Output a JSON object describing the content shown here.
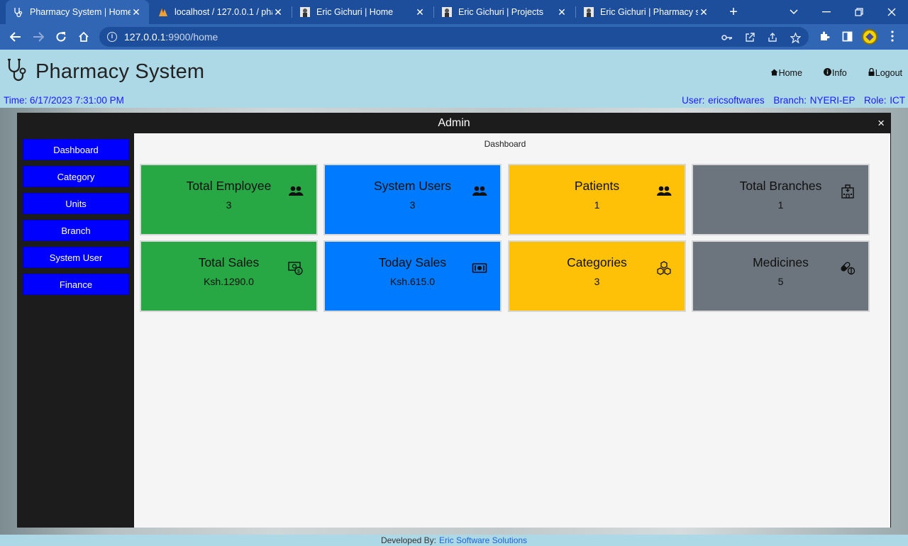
{
  "browser": {
    "tabs": [
      {
        "title": "Pharmacy System | Home"
      },
      {
        "title": "localhost / 127.0.0.1 / pha"
      },
      {
        "title": "Eric Gichuri | Home"
      },
      {
        "title": "Eric Gichuri | Projects"
      },
      {
        "title": "Eric Gichuri | Pharmacy sy"
      }
    ],
    "url_host": "127.0.0.1",
    "url_rest": ":9900/home"
  },
  "header": {
    "app_title": "Pharmacy System",
    "nav": [
      {
        "label": "Home"
      },
      {
        "label": "Info"
      },
      {
        "label": "Logout"
      }
    ],
    "time": "Time: 6/17/2023 7:31:00 PM",
    "user": "User: ericsoftwares",
    "branch": "Branch: NYERI-EP",
    "role": "Role: ICT"
  },
  "panel": {
    "title": "Admin",
    "close": "×",
    "breadcrumb": "Dashboard"
  },
  "sidebar": {
    "items": [
      {
        "label": "Dashboard"
      },
      {
        "label": "Category"
      },
      {
        "label": "Units"
      },
      {
        "label": "Branch"
      },
      {
        "label": "System User"
      },
      {
        "label": "Finance"
      }
    ]
  },
  "cards": [
    {
      "title": "Total Employee",
      "value": "3",
      "color": "#28a745",
      "icon": "users-icon"
    },
    {
      "title": "System Users",
      "value": "3",
      "color": "#007bff",
      "icon": "users-icon"
    },
    {
      "title": "Patients",
      "value": "1",
      "color": "#ffc107",
      "icon": "users-icon"
    },
    {
      "title": "Total Branches",
      "value": "1",
      "color": "#6c757d",
      "icon": "hospital-icon"
    },
    {
      "title": "Total Sales",
      "value": "Ksh.1290.0",
      "color": "#28a745",
      "icon": "cash-coin-icon"
    },
    {
      "title": "Today Sales",
      "value": "Ksh.615.0",
      "color": "#007bff",
      "icon": "cash-icon"
    },
    {
      "title": "Categories",
      "value": "3",
      "color": "#ffc107",
      "icon": "boxes-icon"
    },
    {
      "title": "Medicines",
      "value": "5",
      "color": "#6c757d",
      "icon": "capsule-icon"
    }
  ],
  "footer": {
    "prefix": "Developed By:",
    "link": "Eric Software Solutions"
  }
}
